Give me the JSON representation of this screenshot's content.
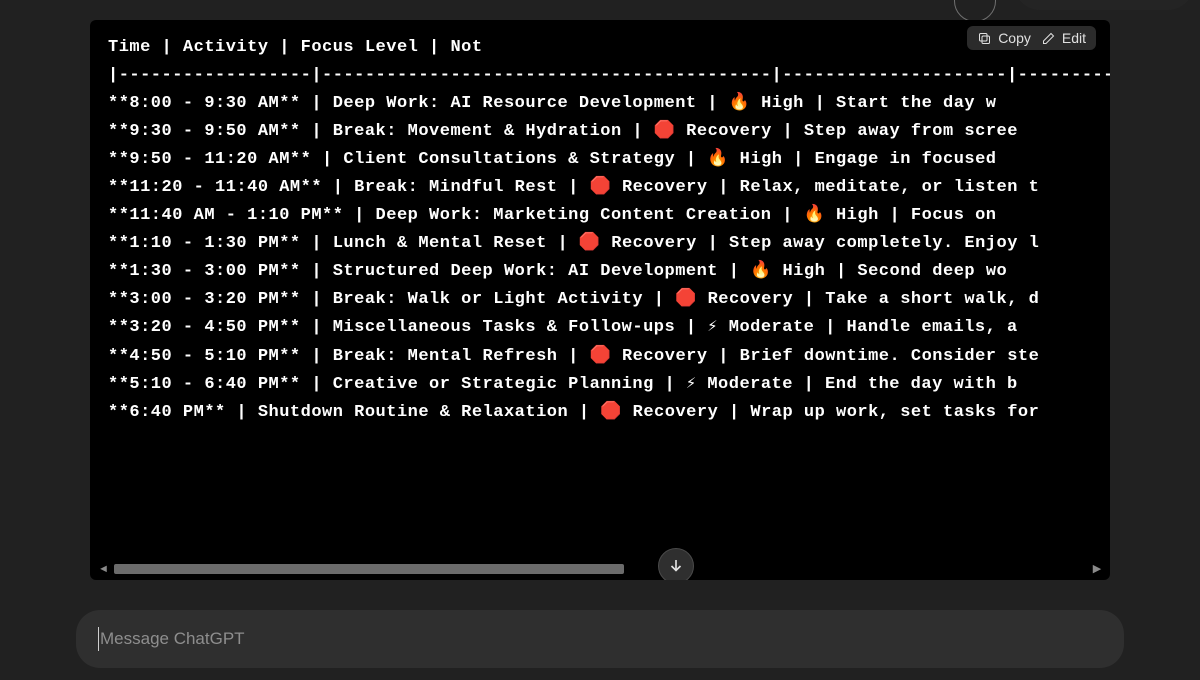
{
  "actions": {
    "copy": "Copy",
    "edit": "Edit"
  },
  "composer": {
    "placeholder": "Message ChatGPT"
  },
  "table": {
    "header": {
      "time": "Time",
      "activity": "Activity",
      "focus": "Focus Level",
      "notes": "Not"
    },
    "rows": [
      {
        "time": "**8:00 - 9:30 AM**",
        "activity": "Deep Work: AI Resource Development",
        "focus_icon": "🔥",
        "focus": "High",
        "notes": "Start the day w"
      },
      {
        "time": "**9:30 - 9:50 AM**",
        "activity": "Break: Movement & Hydration  ",
        "focus_icon": "🛑",
        "focus": "Recovery",
        "notes": "Step away from scree"
      },
      {
        "time": "**9:50 - 11:20 AM**",
        "activity": "Client Consultations & Strategy",
        "focus_icon": "🔥",
        "focus": "High",
        "notes": "Engage in focused "
      },
      {
        "time": "**11:20 - 11:40 AM**",
        "activity": "Break: Mindful Rest",
        "focus_icon": "🛑",
        "focus": "Recovery",
        "notes": "Relax, meditate, or listen t"
      },
      {
        "time": "**11:40 AM - 1:10 PM**",
        "activity": "Deep Work: Marketing Content Creation",
        "focus_icon": "🔥",
        "focus": "High",
        "notes": "Focus on "
      },
      {
        "time": "**1:10 - 1:30 PM**",
        "activity": "Lunch & Mental Reset",
        "focus_icon": "🛑",
        "focus": "Recovery",
        "notes": "Step away completely. Enjoy l"
      },
      {
        "time": "**1:30 - 3:00 PM**",
        "activity": "Structured Deep Work: AI Development",
        "focus_icon": "🔥",
        "focus": "High",
        "notes": "Second deep wo"
      },
      {
        "time": "**3:00 - 3:20 PM**",
        "activity": "Break: Walk or Light Activity",
        "focus_icon": "🛑",
        "focus": "Recovery",
        "notes": "Take a short walk, d"
      },
      {
        "time": "**3:20 - 4:50 PM**",
        "activity": "Miscellaneous Tasks & Follow-ups",
        "focus_icon": "⚡",
        "focus": "Moderate",
        "notes": "Handle emails, a"
      },
      {
        "time": "**4:50 - 5:10 PM**",
        "activity": "Break: Mental Refresh",
        "focus_icon": "🛑",
        "focus": "Recovery",
        "notes": "Brief downtime. Consider ste"
      },
      {
        "time": "**5:10 - 6:40 PM**",
        "activity": "Creative or Strategic Planning",
        "focus_icon": "⚡",
        "focus": "Moderate",
        "notes": "End the day with b"
      },
      {
        "time": "**6:40 PM**",
        "activity": "Shutdown Routine & Relaxation",
        "focus_icon": "🛑",
        "focus": "Recovery",
        "notes": "Wrap up work, set tasks for"
      }
    ]
  }
}
